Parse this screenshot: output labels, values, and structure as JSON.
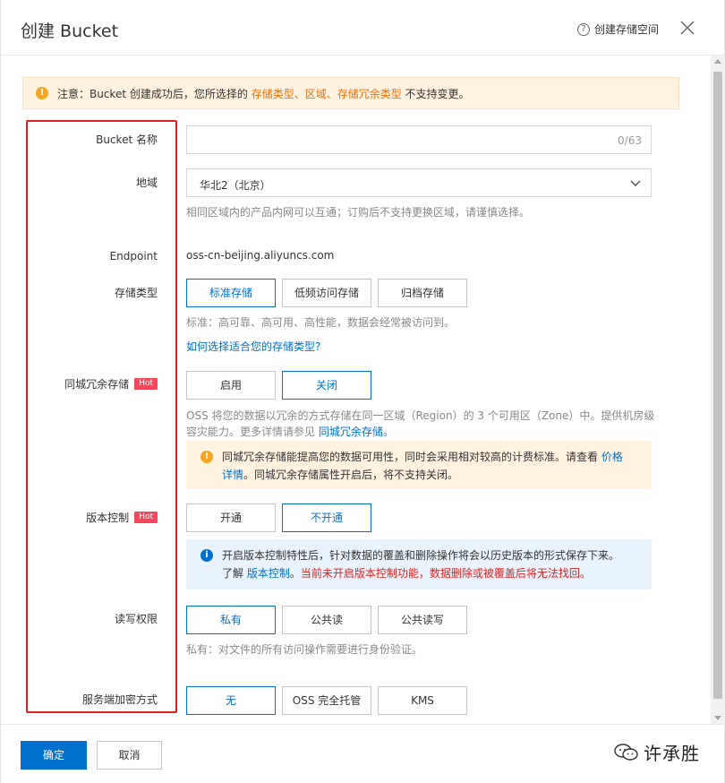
{
  "dialog": {
    "title": "创建 Bucket",
    "help_label": "创建存储空间"
  },
  "notice": {
    "prefix": "注意：Bucket 创建成功后，您所选择的 ",
    "highlight": "存储类型、区域、存储冗余类型",
    "suffix": " 不支持变更。"
  },
  "form": {
    "bucket_name": {
      "label": "Bucket 名称",
      "value": "",
      "counter": "0/63"
    },
    "region": {
      "label": "地域",
      "value": "华北2（北京）",
      "hint": "相同区域内的产品内网可以互通；订购后不支持更换区域，请谨慎选择。"
    },
    "endpoint": {
      "label": "Endpoint",
      "value": "oss-cn-beijing.aliyuncs.com"
    },
    "storage_class": {
      "label": "存储类型",
      "options": [
        "标准存储",
        "低频访问存储",
        "归档存储"
      ],
      "selected": 0,
      "hint": "标准：高可靠、高可用、高性能，数据会经常被访问到。",
      "link": "如何选择适合您的存储类型?"
    },
    "zrs": {
      "label": "同城冗余存储",
      "badge": "Hot",
      "options": [
        "启用",
        "关闭"
      ],
      "selected": 1,
      "hint_line1": "OSS 将您的数据以冗余的方式存储在同一区域（Region）的 3 个可用区（Zone）中。提供机房级",
      "hint_line2": "容灾能力。更多详情请参见 ",
      "hint_link": "同城冗余存储。",
      "alert_text1": "同城冗余存储能提高您的数据可用性，同时会采用相对较高的计费标准。请查看 ",
      "alert_link1": "价格",
      "alert_link2": "详情",
      "alert_text2": "。同城冗余存储属性开启后，将不支持关闭。"
    },
    "versioning": {
      "label": "版本控制",
      "badge": "Hot",
      "options": [
        "开通",
        "不开通"
      ],
      "selected": 1,
      "alert_line1": "开启版本控制特性后，针对数据的覆盖和删除操作将会以历史版本的形式保存下来。",
      "alert_prefix": "了解 ",
      "alert_link": "版本控制",
      "alert_dot": "。",
      "alert_warning": "当前未开启版本控制功能，数据删除或被覆盖后将无法找回。"
    },
    "acl": {
      "label": "读写权限",
      "options": [
        "私有",
        "公共读",
        "公共读写"
      ],
      "selected": 0,
      "hint": "私有：对文件的所有访问操作需要进行身份验证。"
    },
    "encryption": {
      "label": "服务端加密方式",
      "options": [
        "无",
        "OSS 完全托管",
        "KMS"
      ],
      "selected": 0
    }
  },
  "footer": {
    "ok_label": "确定",
    "cancel_label": "取消",
    "watermark": "许承胜"
  },
  "colors": {
    "primary": "#0070cc",
    "warning": "#f07000",
    "danger": "#e02020",
    "hot_badge": "#f5475c"
  },
  "icons": [
    "help-circle-icon",
    "close-icon",
    "warning-icon",
    "chevron-down-icon",
    "info-icon",
    "wechat-icon"
  ]
}
